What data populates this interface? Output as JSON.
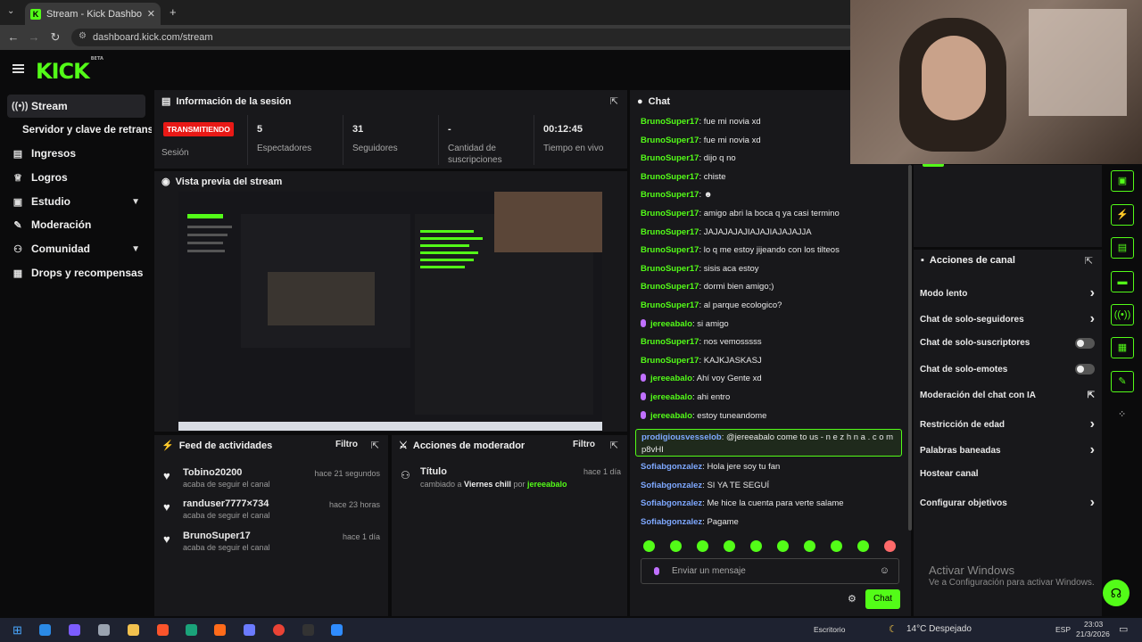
{
  "browser": {
    "tab_title": "Stream - Kick Dashboard",
    "url": "dashboard.kick.com/stream"
  },
  "logo": {
    "text": "KICK",
    "beta": "BETA"
  },
  "sidebar": {
    "items": [
      {
        "label": "Stream",
        "icon": "broadcast-icon"
      },
      {
        "label": "Servidor y clave de retransm",
        "icon": ""
      },
      {
        "label": "Ingresos",
        "icon": "money-icon"
      },
      {
        "label": "Logros",
        "icon": "trophy-icon"
      },
      {
        "label": "Estudio",
        "icon": "studio-icon"
      },
      {
        "label": "Moderación",
        "icon": "wrench-icon"
      },
      {
        "label": "Comunidad",
        "icon": "people-icon"
      },
      {
        "label": "Drops y recompensas",
        "icon": "gift-icon"
      }
    ]
  },
  "session": {
    "title": "Información de la sesión",
    "live_badge": "TRANSMITIENDO",
    "session_label": "Sesión",
    "stats": [
      {
        "value": "5",
        "label": "Espectadores"
      },
      {
        "value": "31",
        "label": "Seguidores"
      },
      {
        "value": "-",
        "label": "Cantidad de suscripciones"
      },
      {
        "value": "00:12:45",
        "label": "Tiempo en vivo"
      }
    ]
  },
  "preview": {
    "title": "Vista previa del stream"
  },
  "feed": {
    "title": "Feed de actividades",
    "filter": "Filtro",
    "items": [
      {
        "name": "Tobino20200",
        "sub": "acaba de seguir el canal",
        "time": "hace 21 segundos"
      },
      {
        "name": "randuser7777×734",
        "sub": "acaba de seguir el canal",
        "time": "hace 23 horas"
      },
      {
        "name": "BrunoSuper17",
        "sub": "acaba de seguir el canal",
        "time": "hace 1 día"
      }
    ]
  },
  "mod_actions": {
    "title": "Acciones de moderador",
    "filter": "Filtro",
    "item": {
      "title": "Título",
      "prefix": "cambiado a",
      "value": "Viernes chill",
      "by": "por",
      "user": "jereeabalo",
      "time": "hace 1 día"
    }
  },
  "chat": {
    "title": "Chat",
    "messages": [
      {
        "user": "BrunoSuper17",
        "text": "fue mi novia xd",
        "color": "green"
      },
      {
        "user": "BrunoSuper17",
        "text": "fue mi novia xd",
        "color": "green"
      },
      {
        "user": "BrunoSuper17",
        "text": "dijo q no",
        "color": "green"
      },
      {
        "user": "BrunoSuper17",
        "text": "chiste",
        "color": "green"
      },
      {
        "user": "BrunoSuper17",
        "text": "",
        "color": "green"
      },
      {
        "user": "BrunoSuper17",
        "text": "amigo abri la boca q ya casi termino",
        "color": "green"
      },
      {
        "user": "BrunoSuper17",
        "text": "JAJAJAJAJIAJAJIAJAJAJJA",
        "color": "green"
      },
      {
        "user": "BrunoSuper17",
        "text": "lo q me estoy jijeando con los tilteos",
        "color": "green"
      },
      {
        "user": "BrunoSuper17",
        "text": "sisis aca estoy",
        "color": "green"
      },
      {
        "user": "BrunoSuper17",
        "text": "dormi bien amigo;)",
        "color": "green"
      },
      {
        "user": "BrunoSuper17",
        "text": "al parque ecologico?",
        "color": "green"
      },
      {
        "user": "jereeabalo",
        "text": "si amigo",
        "color": "green",
        "mic": true
      },
      {
        "user": "BrunoSuper17",
        "text": "nos vemosssss",
        "color": "green"
      },
      {
        "user": "BrunoSuper17",
        "text": "KAJKJASKASJ",
        "color": "green"
      },
      {
        "user": "jereeabalo",
        "text": "Ahí voy Gente xd",
        "color": "green",
        "mic": true
      },
      {
        "user": "jereeabalo",
        "text": "ahi entro",
        "color": "green",
        "mic": true
      },
      {
        "user": "jereeabalo",
        "text": "estoy tuneandome",
        "color": "green",
        "mic": true
      }
    ],
    "highlight": {
      "user": "prodigiousvesselob",
      "text": "@jereeabalo come to us - n e z h n a . c o m",
      "text2": "p8vHI"
    },
    "messages2": [
      {
        "user": "Sofiabgonzalez",
        "text": "Hola jere soy tu fan"
      },
      {
        "user": "Sofiabgonzalez",
        "text": "SI YA TE SEGUÍ"
      },
      {
        "user": "Sofiabgonzalez",
        "text": "Me hice la cuenta para verte salame"
      },
      {
        "user": "Sofiabgonzalez",
        "text": "Pagame"
      }
    ],
    "input_placeholder": "Enviar un mensaje",
    "send_label": "Chat"
  },
  "channel_actions": {
    "title": "Acciones de canal",
    "items": [
      {
        "label": "Modo lento",
        "control": "chevron"
      },
      {
        "label": "Chat de solo-seguidores",
        "control": "chevron"
      },
      {
        "label": "Chat de solo-suscriptores",
        "control": "toggle"
      },
      {
        "label": "Chat de solo-emotes",
        "control": "toggle"
      },
      {
        "label": "Moderación del chat con IA",
        "control": "external"
      },
      {
        "label": "Restricción de edad",
        "control": "chevron"
      },
      {
        "label": "Palabras baneadas",
        "control": "chevron"
      },
      {
        "label": "Hostear canal",
        "control": "none"
      },
      {
        "label": "Configurar objetivos",
        "control": "chevron"
      }
    ]
  },
  "windows": {
    "activate_title": "Activar Windows",
    "activate_sub": "Ve a Configuración para activar Windows.",
    "desktop": "Escritorio",
    "weather": "14°C  Despejado",
    "lang": "ESP",
    "time": "23:03",
    "date": "21/3/2026"
  },
  "colors": {
    "accent": "#53fc18",
    "live": "#e91916",
    "panel": "#18181b"
  }
}
